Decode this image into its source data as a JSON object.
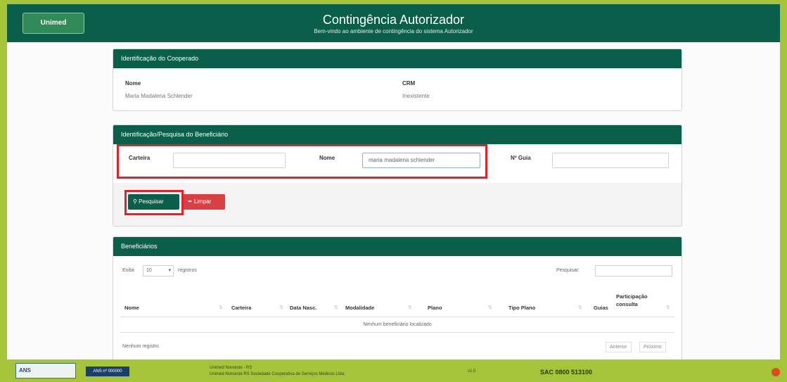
{
  "header": {
    "logo_text": "Unimed",
    "title": "Contingência Autorizador",
    "subtitle": "Bem-vindo ao ambiente de contingência do sistema Autorizador"
  },
  "cooperado": {
    "panel_title": "Identificação do Cooperado",
    "name_label": "Nome",
    "name_value": "Maria Madalena Schlender",
    "crm_label": "CRM",
    "crm_value": "Inexistente"
  },
  "beneficiario_search": {
    "panel_title": "Identificação/Pesquisa do Beneficiário",
    "carteira_label": "Carteira",
    "carteira_value": "",
    "nome_label": "Nome",
    "nome_value": "maria madalena schlender",
    "guia_label": "Nº Guia",
    "guia_value": "",
    "search_button": "Pesquisar",
    "clear_button": "Limpar"
  },
  "beneficiarios": {
    "panel_title": "Beneficiários",
    "show_label": "Exibir",
    "page_size": "10",
    "records_label": "registros",
    "search_label": "Pesquisar:",
    "columns": [
      "Nome",
      "Carteira",
      "Data Nasc.",
      "Modalidade",
      "Plano",
      "Tipo Plano",
      "Guias",
      "Participação consulta"
    ],
    "empty_message": "Nenhum beneficiário localizado",
    "info_text": "Nenhum registro",
    "prev_label": "Anterior",
    "next_label": "Próximo"
  },
  "footer": {
    "ans_logo": "ANS",
    "ans_badge": "ANS nº 000000",
    "line1": "Unimed Noroeste - RS",
    "line2": "Unimed Noroeste RS Sociedade Cooperativa de Serviços Médicos Ltda.",
    "version": "v1.0",
    "sac": "SAC 0800 513100"
  },
  "colors": {
    "primary": "#0a5f4a",
    "accent": "#a6c43a",
    "danger": "#d84044",
    "highlight": "#e0202a"
  }
}
